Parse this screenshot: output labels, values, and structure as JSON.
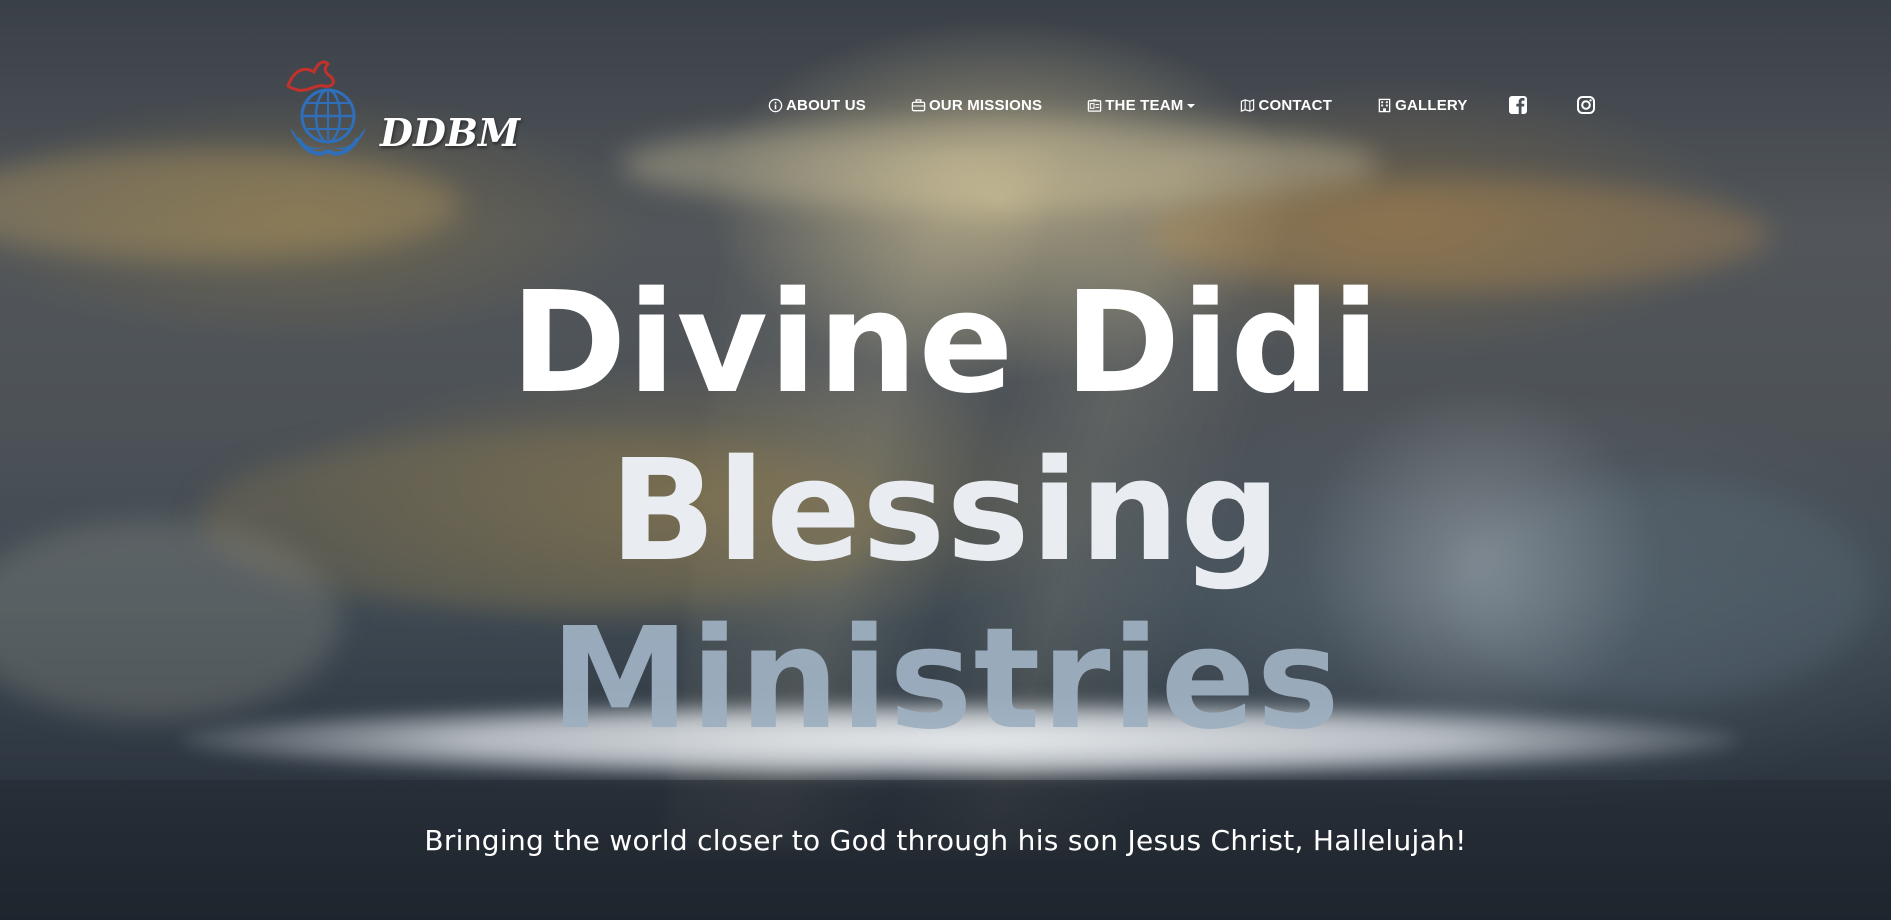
{
  "brand": {
    "logo_text": "DDBM",
    "colors": {
      "globe": "#2f6fba",
      "dove": "#c0322b"
    }
  },
  "nav": {
    "items": [
      {
        "label": "ABOUT US",
        "icon": "info-circle-icon"
      },
      {
        "label": "OUR MISSIONS",
        "icon": "briefcase-icon"
      },
      {
        "label": "THE TEAM",
        "icon": "id-card-icon",
        "has_dropdown": true
      },
      {
        "label": "CONTACT",
        "icon": "map-icon"
      },
      {
        "label": "GALLERY",
        "icon": "building-icon"
      }
    ],
    "social": [
      {
        "name": "facebook-icon"
      },
      {
        "name": "instagram-icon"
      }
    ]
  },
  "hero": {
    "title_line1": "Divine Didi",
    "title_line2": "Blessing",
    "title_line3": "Ministries",
    "tagline": "Bringing the world closer to God through his son Jesus Christ, Hallelujah!"
  }
}
